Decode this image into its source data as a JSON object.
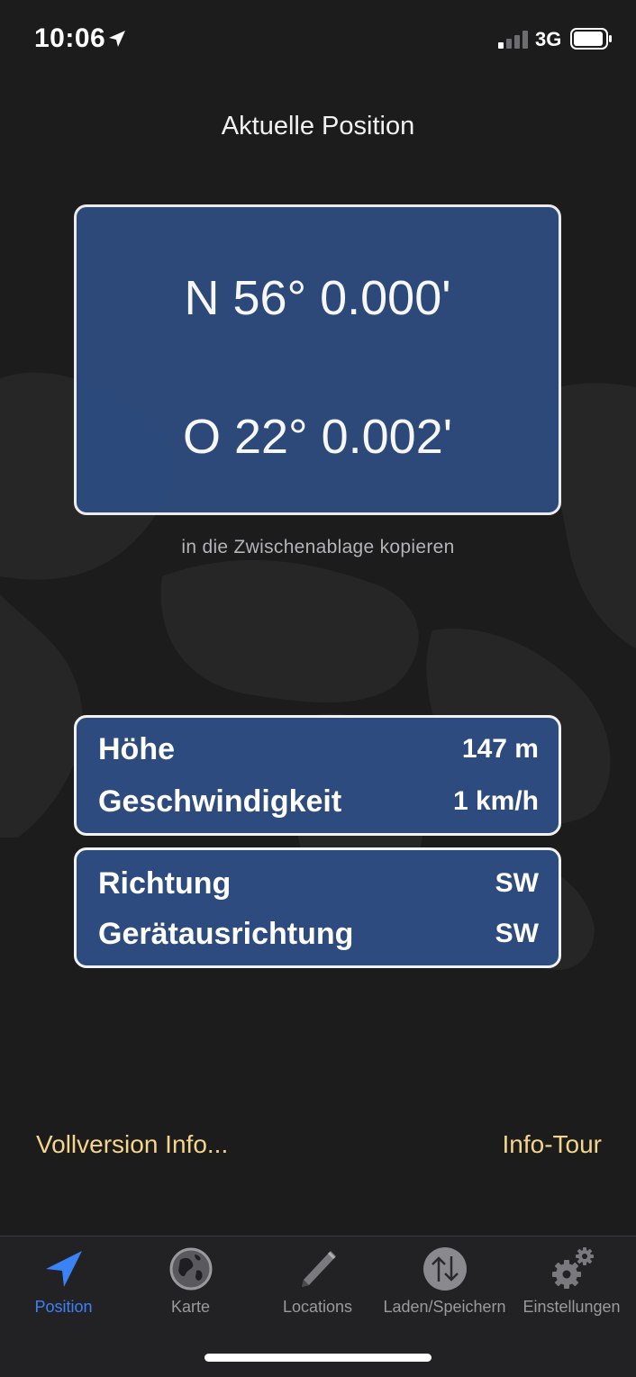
{
  "status_bar": {
    "time": "10:06",
    "network": "3G"
  },
  "page_title": "Aktuelle Position",
  "coordinates": {
    "north": "N 56° 0.000'",
    "east": "O 22° 0.002'"
  },
  "clipboard_link": "in die Zwischenablage kopieren",
  "info_box_1": {
    "rows": [
      {
        "label": "Höhe",
        "value": "147 m"
      },
      {
        "label": "Geschwindigkeit",
        "value": "1 km/h"
      }
    ]
  },
  "info_box_2": {
    "rows": [
      {
        "label": "Richtung",
        "value": "SW"
      },
      {
        "label": "Gerätausrichtung",
        "value": "SW"
      }
    ]
  },
  "links": {
    "full_version": "Vollversion Info...",
    "info_tour": "Info-Tour"
  },
  "tab_bar": {
    "tabs": [
      {
        "label": "Position",
        "icon": "navigation-arrow-icon",
        "active": true
      },
      {
        "label": "Karte",
        "icon": "globe-icon",
        "active": false
      },
      {
        "label": "Locations",
        "icon": "pencil-icon",
        "active": false
      },
      {
        "label": "Laden/Speichern",
        "icon": "up-down-arrows-icon",
        "active": false
      },
      {
        "label": "Einstellungen",
        "icon": "gears-icon",
        "active": false
      }
    ]
  },
  "colors": {
    "box_fill": "#2d4b7e",
    "link_yellow": "#f3d58b",
    "active_tab_blue": "#3b82f6"
  }
}
